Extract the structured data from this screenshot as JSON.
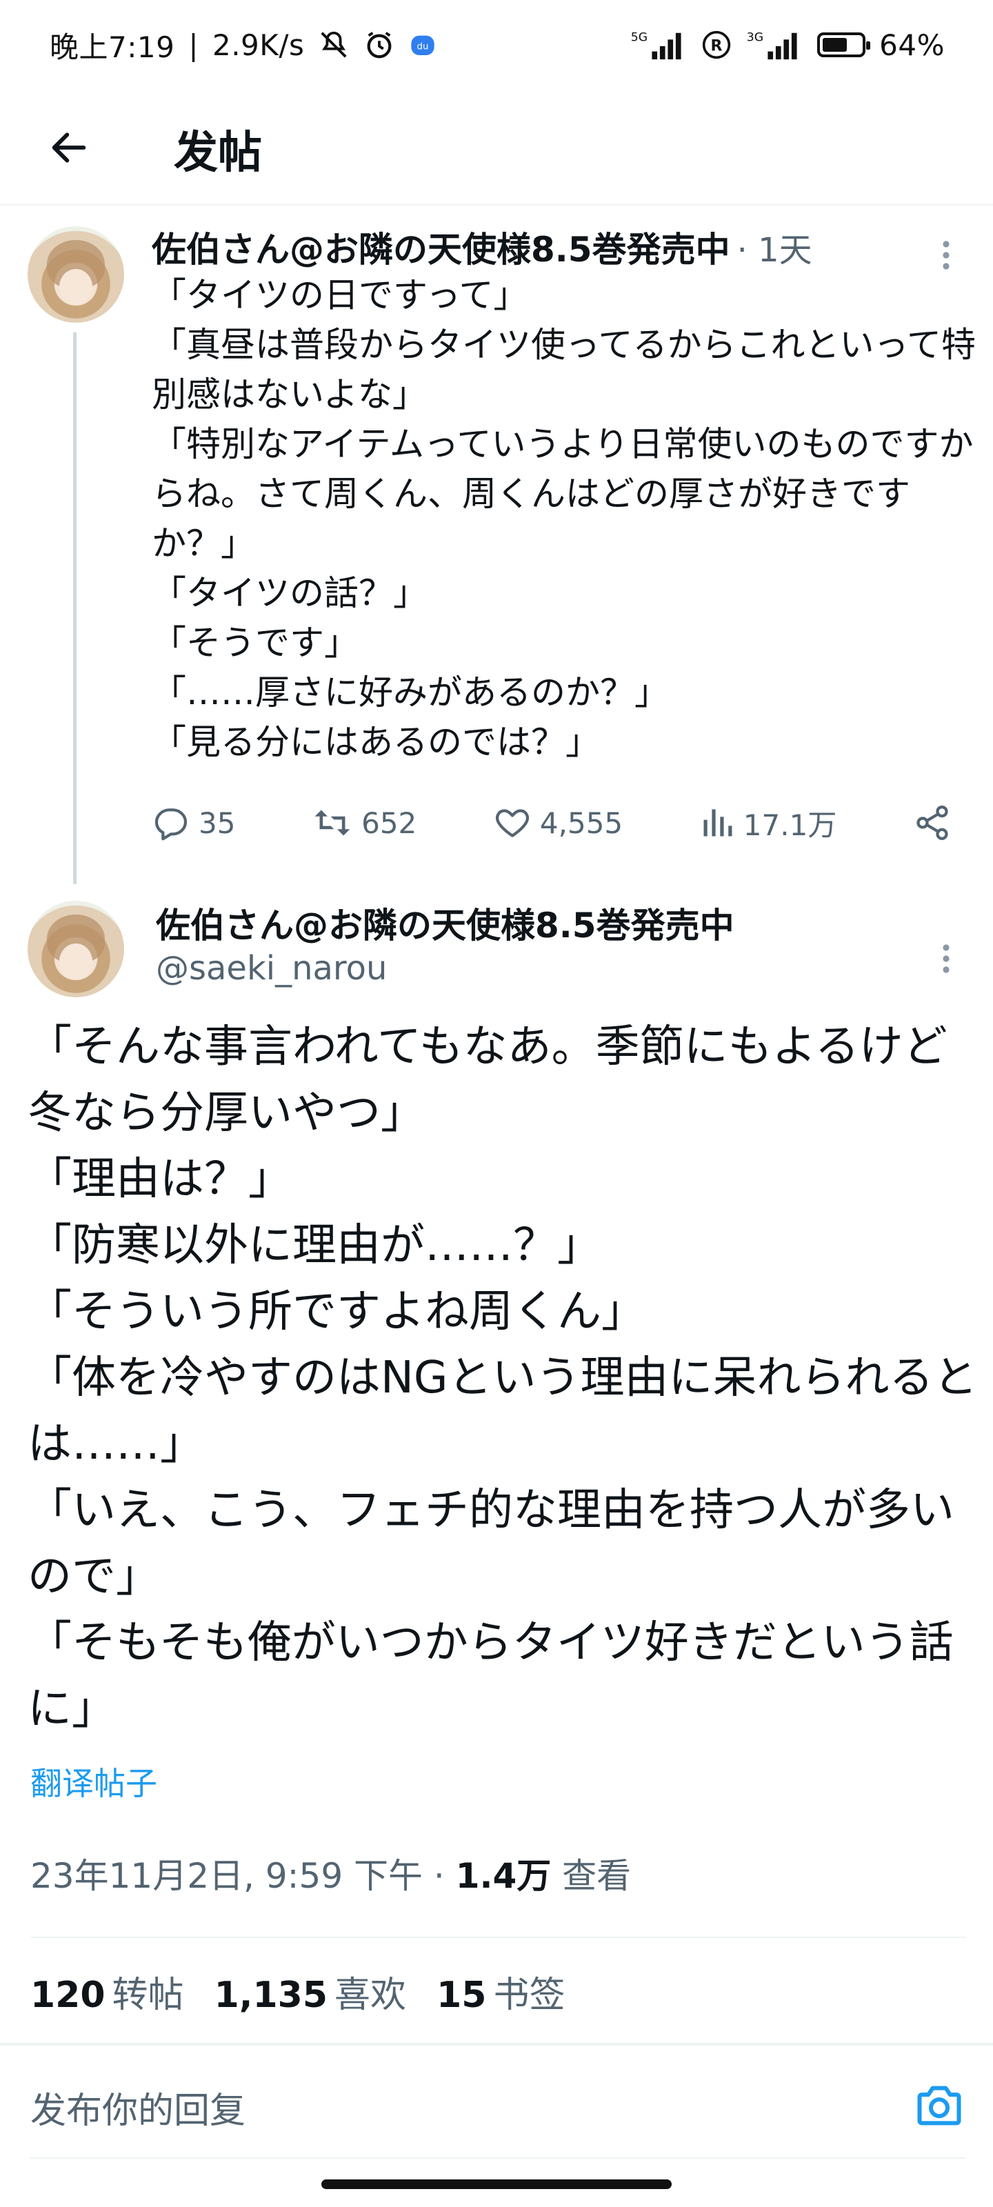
{
  "status_bar": {
    "time": "晚上7:19",
    "speed": "2.9K/s",
    "network_1": "5G",
    "network_2": "3G",
    "battery": "64%",
    "battery_level": 0.64
  },
  "header": {
    "title": "发帖"
  },
  "parent_tweet": {
    "author": "佐伯さん@お隣の天使様8.5巻発売中",
    "time": "· 1天",
    "text": "「タイツの日ですって」\n「真昼は普段からタイツ使ってるからこれといって特別感はないよな」\n「特別なアイテムっていうより日常使いのものですからね。さて周くん、周くんはどの厚さが好きですか？」\n「タイツの話？」\n「そうです」\n「……厚さに好みがあるのか？」\n「見る分にはあるのでは？」",
    "replies": "35",
    "retweets": "652",
    "likes": "4,555",
    "views": "17.1万"
  },
  "main_tweet": {
    "author": "佐伯さん@お隣の天使様8.5巻発売中",
    "handle": "@saeki_narou",
    "text": "「そんな事言われてもなあ。季節にもよるけど冬なら分厚いやつ」\n「理由は？」\n「防寒以外に理由が……？」\n「そういう所ですよね周くん」\n「体を冷やすのはNGという理由に呆れられるとは……」\n「いえ、こう、フェチ的な理由を持つ人が多いので」\n「そもそも俺がいつからタイツ好きだという話に」",
    "translate_label": "翻译帖子",
    "timestamp": "23年11月2日, 9:59 下午 · ",
    "views_count": "1.4万",
    "views_label": " 查看",
    "stats": {
      "retweets_num": "120",
      "retweets_label": "转帖",
      "likes_num": "1,135",
      "likes_label": "喜欢",
      "bookmarks_num": "15",
      "bookmarks_label": "书签"
    }
  },
  "reply": {
    "placeholder": "发布你的回复"
  },
  "colors": {
    "accent": "#1d9bf0",
    "secondary_text": "#536471",
    "primary_text": "#0f1419",
    "divider": "#eff3f4"
  }
}
